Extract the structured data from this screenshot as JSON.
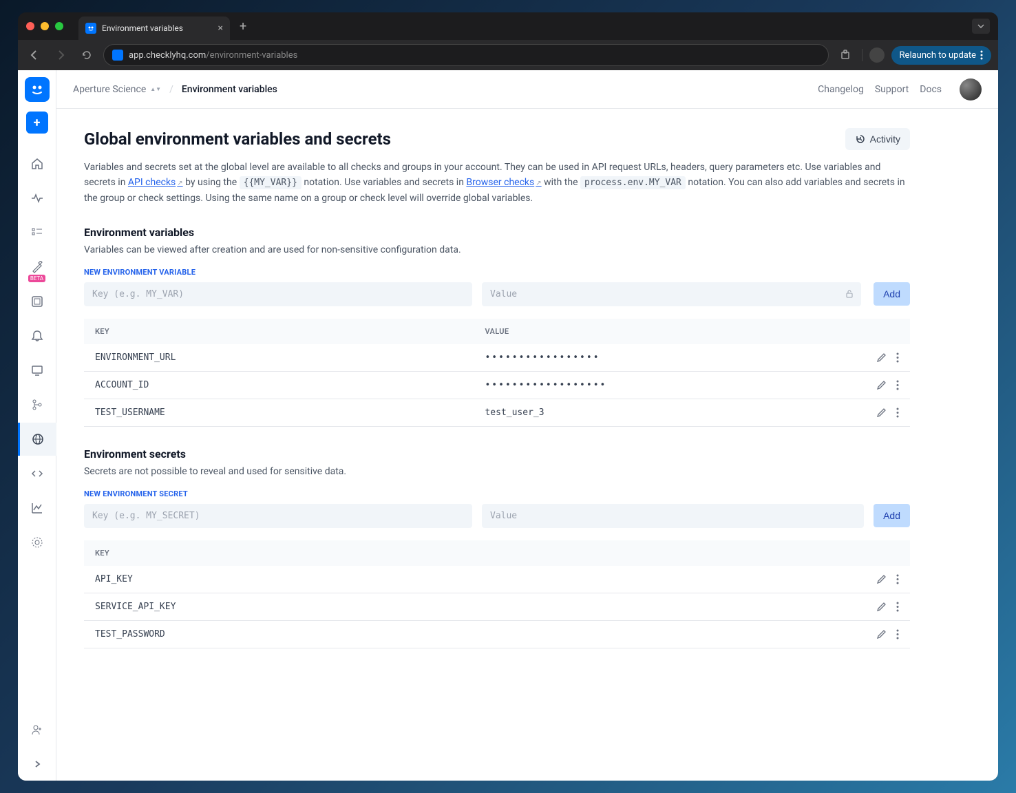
{
  "browser": {
    "tab_title": "Environment variables",
    "url_host": "app.checklyhq.com",
    "url_path": "/environment-variables",
    "relaunch": "Relaunch to update"
  },
  "header": {
    "org": "Aperture Science",
    "page": "Environment variables",
    "changelog": "Changelog",
    "support": "Support",
    "docs": "Docs"
  },
  "sidebar": {
    "beta_badge": "BETA"
  },
  "page": {
    "title": "Global environment variables and secrets",
    "activity": "Activity",
    "desc_1": "Variables and secrets set at the global level are available to all checks and groups in your account. They can be used in API request URLs, headers, query parameters etc. Use variables and secrets in ",
    "api_checks_link": "API checks",
    "desc_2": " by using the ",
    "code_1": "{{MY_VAR}}",
    "desc_3": " notation. Use variables and secrets in ",
    "browser_checks_link": "Browser checks",
    "desc_4": " with the ",
    "code_2": "process.env.MY_VAR",
    "desc_5": " notation. You can also add variables and secrets in the group or check settings. Using the same name on a group or check level will override global variables."
  },
  "env_vars": {
    "section_title": "Environment variables",
    "section_desc": "Variables can be viewed after creation and are used for non-sensitive configuration data.",
    "form_label": "NEW ENVIRONMENT VARIABLE",
    "key_placeholder": "Key (e.g. MY_VAR)",
    "value_placeholder": "Value",
    "add_label": "Add",
    "th_key": "KEY",
    "th_value": "VALUE",
    "rows": [
      {
        "key": "ENVIRONMENT_URL",
        "value": "•••••••••••••••••",
        "masked": true
      },
      {
        "key": "ACCOUNT_ID",
        "value": "••••••••••••••••••",
        "masked": true
      },
      {
        "key": "TEST_USERNAME",
        "value": "test_user_3",
        "masked": false
      }
    ]
  },
  "secrets": {
    "section_title": "Environment secrets",
    "section_desc": "Secrets are not possible to reveal and used for sensitive data.",
    "form_label": "NEW ENVIRONMENT SECRET",
    "key_placeholder": "Key (e.g. MY_SECRET)",
    "value_placeholder": "Value",
    "add_label": "Add",
    "th_key": "KEY",
    "rows": [
      {
        "key": "API_KEY"
      },
      {
        "key": "SERVICE_API_KEY"
      },
      {
        "key": "TEST_PASSWORD"
      }
    ]
  }
}
